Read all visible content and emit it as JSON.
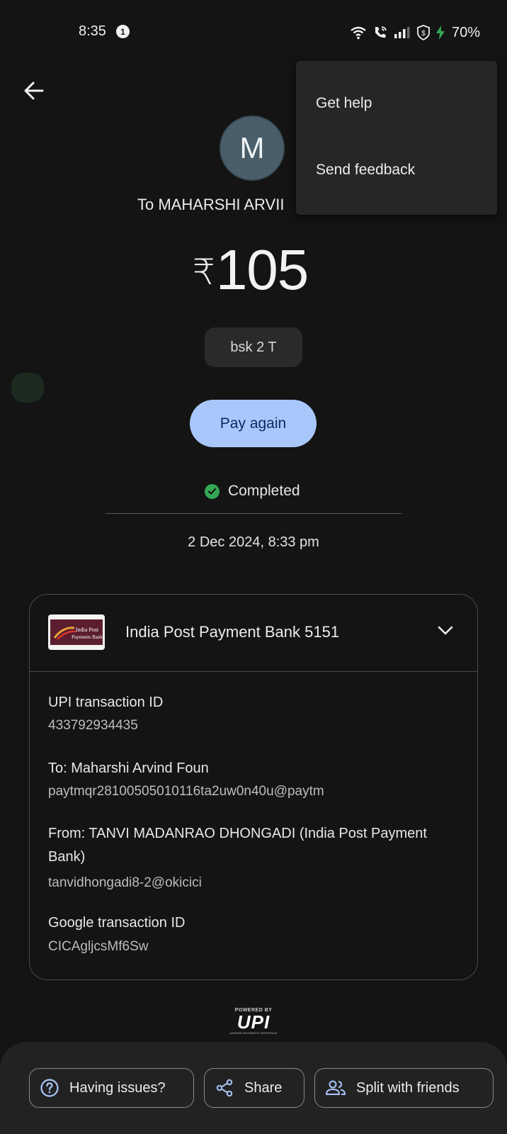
{
  "status_bar": {
    "time": "8:35",
    "notification_count": "1",
    "battery": "70%"
  },
  "payee": {
    "initial": "M",
    "to_label": "To MAHARSHI ARVII",
    "amount_currency": "₹",
    "amount_value": "105",
    "note": "bsk 2 T"
  },
  "actions": {
    "pay_again": "Pay again"
  },
  "transaction": {
    "status": "Completed",
    "datetime": "2 Dec 2024, 8:33 pm",
    "bank_account": "India Post Payment Bank 5151",
    "fields": [
      {
        "label": "UPI transaction ID",
        "value": "433792934435"
      },
      {
        "label": "To: Maharshi Arvind Foun",
        "value": "paytmqr28100505010116ta2uw0n40u@paytm"
      },
      {
        "label": "From: TANVI MADANRAO DHONGADI (India Post Payment Bank)",
        "value": "tanvidhongadi8-2@okicici"
      },
      {
        "label": "Google transaction ID",
        "value": "CICAgljcsMf6Sw"
      }
    ]
  },
  "upi_logo": {
    "powered_by": "POWERED BY",
    "name": "UPI",
    "subtitle": "UNIFIED PAYMENTS INTERFACE"
  },
  "bottom_actions": {
    "issues": "Having issues?",
    "share": "Share",
    "split": "Split with friends"
  },
  "menu": {
    "items": [
      "Get help",
      "Send feedback"
    ]
  },
  "colors": {
    "background": "#141414",
    "accent_button": "#a8c7fa",
    "success": "#34a853"
  }
}
